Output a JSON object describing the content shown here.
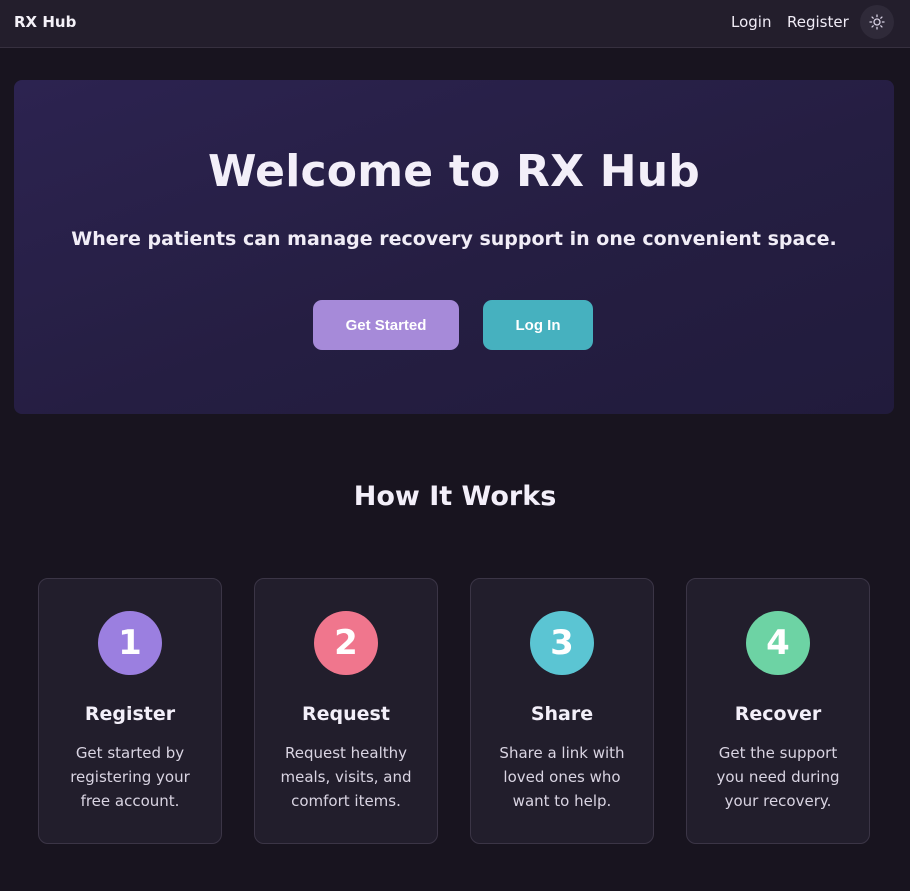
{
  "nav": {
    "brand": "RX Hub",
    "login": "Login",
    "register": "Register",
    "theme_icon": "sun-icon"
  },
  "hero": {
    "title": "Welcome to RX Hub",
    "subtitle": "Where patients can manage recovery support in one convenient space.",
    "primary_button": "Get Started",
    "secondary_button": "Log In"
  },
  "how_it_works": {
    "title": "How It Works",
    "steps": [
      {
        "number": "1",
        "title": "Register",
        "text": "Get started by registering your free account.",
        "color": "#9b7fe0"
      },
      {
        "number": "2",
        "title": "Request",
        "text": "Request healthy meals, visits, and comfort items.",
        "color": "#f0768d"
      },
      {
        "number": "3",
        "title": "Share",
        "text": "Share a link with loved ones who want to help.",
        "color": "#5bc5d3"
      },
      {
        "number": "4",
        "title": "Recover",
        "text": "Get the support you need during your recovery.",
        "color": "#6dd3a4"
      }
    ]
  },
  "colors": {
    "background": "#18141f",
    "accent_primary": "#a68ad9",
    "accent_secondary": "#46b1bf"
  }
}
